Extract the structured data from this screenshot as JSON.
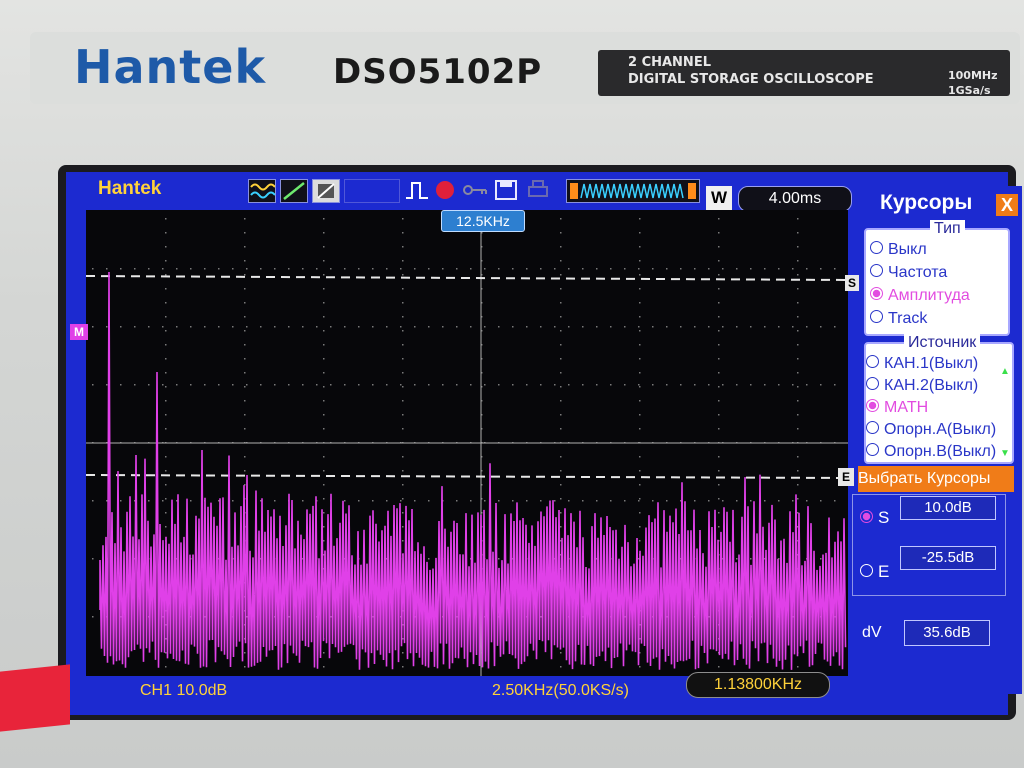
{
  "device": {
    "brand": "Hantek",
    "model": "DSO5102P",
    "plate_line1": "2 CHANNEL",
    "plate_line2": "DIGITAL STORAGE OSCILLOSCOPE",
    "spec1": "100MHz",
    "spec2": "1GSa/s"
  },
  "screen": {
    "logo": "Hantek",
    "timebase": "4.00ms",
    "w_label": "W",
    "trigger_freq": "12.5KHz",
    "marker_m": "M",
    "marker_s": "S",
    "marker_e": "E"
  },
  "status_bar": {
    "ch1": "CH1  10.0dB",
    "scale": "2.50KHz(50.0KS/s)",
    "freq": "1.13800KHz"
  },
  "cursor_menu": {
    "title": "Курсоры",
    "close": "X",
    "type_header": "Тип",
    "type_options": [
      "Выкл",
      "Частота",
      "Амплитуда",
      "Track"
    ],
    "type_selected": 2,
    "source_header": "Источник",
    "source_options": [
      "КАН.1(Выкл)",
      "КАН.2(Выкл)",
      "MATH",
      "Опорн.А(Выкл)",
      "Опорн.В(Выкл)"
    ],
    "source_selected": 2,
    "select_label": "Выбрать Курсоры",
    "s_label": "S",
    "s_value": "10.0dB",
    "e_label": "E",
    "e_value": "-25.5dB",
    "dv_label": "dV",
    "dv_value": "35.6dB"
  },
  "colors": {
    "trace": "#e040e8",
    "screen_blue": "#1c2ad0",
    "label_yellow": "#ffd23a",
    "menu_orange": "#f07c18"
  }
}
